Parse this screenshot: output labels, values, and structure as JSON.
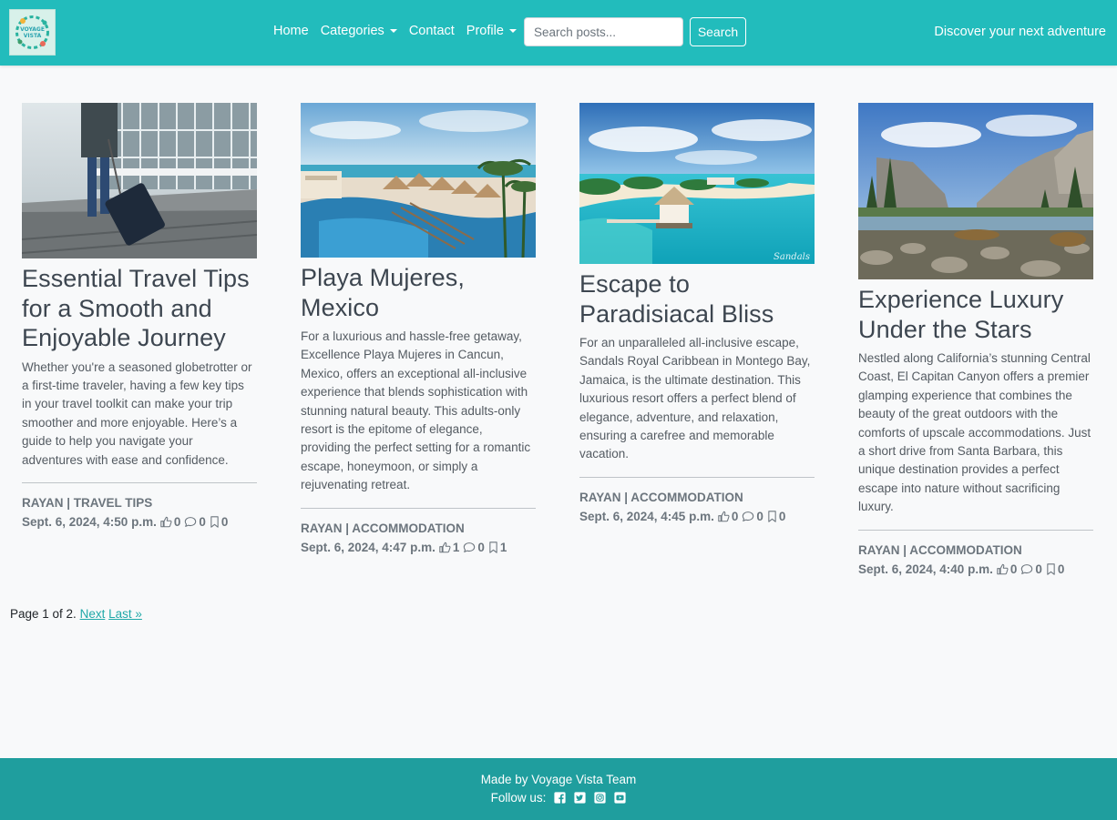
{
  "nav": {
    "logo_alt": "Voyage Vista",
    "links": [
      {
        "label": "Home",
        "has_caret": false
      },
      {
        "label": "Categories",
        "has_caret": true
      },
      {
        "label": "Contact",
        "has_caret": false
      },
      {
        "label": "Profile",
        "has_caret": true
      }
    ],
    "search_placeholder": "Search posts...",
    "search_button": "Search",
    "tagline": "Discover your next adventure"
  },
  "posts": [
    {
      "title": "Essential Travel Tips for a Smooth and Enjoyable Journey",
      "excerpt": "Whether you're a seasoned globetrotter or a first-time traveler, having a few key tips in your travel toolkit can make your trip smoother and more enjoyable. Here’s a guide to help you navigate your adventures with ease and confidence.",
      "meta": "RAYAN | TRAVEL TIPS",
      "date": "Sept. 6, 2024, 4:50 p.m.",
      "likes": "0",
      "comments": "0",
      "bookmarks": "0",
      "image": "traveler-with-suitcase-at-airport"
    },
    {
      "title": "Playa Mujeres, Mexico",
      "excerpt": "For a luxurious and hassle-free getaway, Excellence Playa Mujeres in Cancun, Mexico, offers an exceptional all-inclusive experience that blends sophistication with stunning natural beauty. This adults-only resort is the epitome of elegance, providing the perfect setting for a romantic escape, honeymoon, or simply a rejuvenating retreat.",
      "meta": "RAYAN | ACCOMMODATION",
      "date": "Sept. 6, 2024, 4:47 p.m.",
      "likes": "1",
      "comments": "0",
      "bookmarks": "1",
      "image": "beach-resort-with-pool"
    },
    {
      "title": "Escape to Paradisiacal Bliss",
      "excerpt": "For an unparalleled all-inclusive escape, Sandals Royal Caribbean in Montego Bay, Jamaica, is the ultimate destination. This luxurious resort offers a perfect blend of elegance, adventure, and relaxation, ensuring a carefree and memorable vacation.",
      "meta": "RAYAN | ACCOMMODATION",
      "date": "Sept. 6, 2024, 4:45 p.m.",
      "likes": "0",
      "comments": "0",
      "bookmarks": "0",
      "image": "tropical-island-gazebo",
      "image_watermark": "Sandals"
    },
    {
      "title": "Experience Luxury Under the Stars",
      "excerpt": "Nestled along California’s stunning Central Coast, El Capitan Canyon offers a premier glamping experience that combines the beauty of the great outdoors with the comforts of upscale accommodations. Just a short drive from Santa Barbara, this unique destination provides a perfect escape into nature without sacrificing luxury.",
      "meta": "RAYAN | ACCOMMODATION",
      "date": "Sept. 6, 2024, 4:40 p.m.",
      "likes": "0",
      "comments": "0",
      "bookmarks": "0",
      "image": "mountain-valley-river"
    }
  ],
  "pagination": {
    "text": "Page 1 of 2.",
    "next": "Next",
    "last": "Last »"
  },
  "footer": {
    "credit": "Made by Voyage Vista Team",
    "follow": "Follow us:",
    "social_icons": [
      "facebook-icon",
      "twitter-icon",
      "instagram-icon",
      "youtube-icon"
    ]
  },
  "colors": {
    "brand": "#22bcbc",
    "footer": "#1f9e9e",
    "link": "#20a8a8",
    "background": "#f8f9fa"
  }
}
